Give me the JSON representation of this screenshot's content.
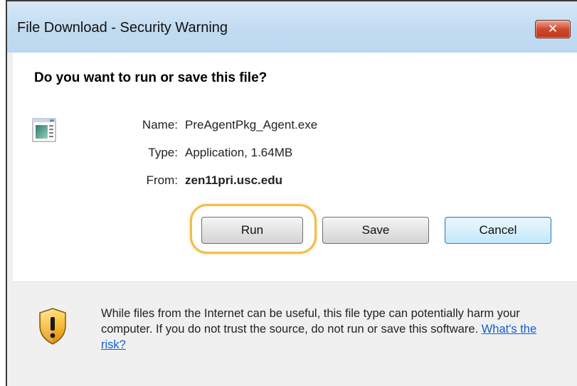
{
  "window": {
    "title": "File Download - Security Warning",
    "close_icon": "close-icon",
    "close_symbol": "✕"
  },
  "dialog": {
    "question": "Do you want to run or save this file?",
    "file_icon": "application-file-icon",
    "fields": {
      "name_label": "Name:",
      "name_value": "PreAgentPkg_Agent.exe",
      "type_label": "Type:",
      "type_value": "Application, 1.64MB",
      "from_label": "From:",
      "from_value": "zen11pri.usc.edu"
    },
    "buttons": {
      "run": "Run",
      "save": "Save",
      "cancel": "Cancel"
    },
    "highlighted_button": "Run",
    "highlight_color": "#f1bd49",
    "warning": {
      "icon": "shield-warning-icon",
      "text": "While files from the Internet can be useful, this file type can potentially harm your computer. If you do not trust the source, do not run or save this software.",
      "link": "What's the risk?"
    }
  }
}
